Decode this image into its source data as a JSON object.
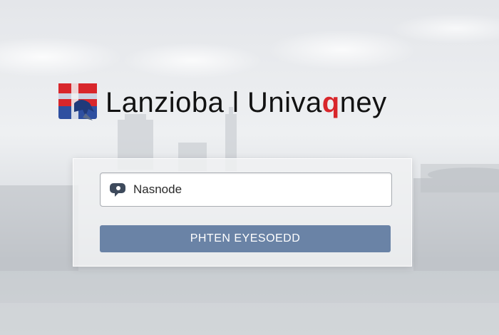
{
  "brand": {
    "name": "Lanzioba l Univa",
    "name_accent": "q",
    "name_tail": "ney",
    "logo_icon": "university-shield-icon",
    "accent_color": "#d8262b",
    "primary_color": "#2e4fa0"
  },
  "login": {
    "username_icon": "user-chat-icon",
    "username_value": "Nasnode",
    "submit_label": "PHTEN EYESOEDD",
    "button_color": "#6a83a6"
  }
}
